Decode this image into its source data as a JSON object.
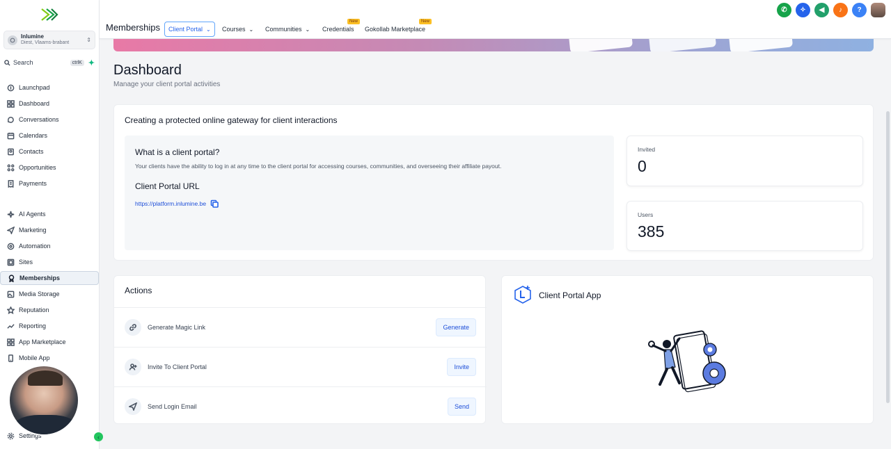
{
  "account": {
    "name": "Inlumine",
    "location": "Diest, Vlaams-brabant"
  },
  "search": {
    "label": "Search",
    "shortcut": "ctrlK"
  },
  "nav": [
    {
      "label": "Launchpad",
      "icon": "rocket-icon"
    },
    {
      "label": "Dashboard",
      "icon": "grid-icon"
    },
    {
      "label": "Conversations",
      "icon": "chat-icon"
    },
    {
      "label": "Calendars",
      "icon": "calendar-icon"
    },
    {
      "label": "Contacts",
      "icon": "contact-icon"
    },
    {
      "label": "Opportunities",
      "icon": "nodes-icon"
    },
    {
      "label": "Payments",
      "icon": "receipt-icon"
    },
    {
      "label": "AI Agents",
      "icon": "sparkle-icon"
    },
    {
      "label": "Marketing",
      "icon": "send-icon"
    },
    {
      "label": "Automation",
      "icon": "automation-icon"
    },
    {
      "label": "Sites",
      "icon": "globe-icon"
    },
    {
      "label": "Memberships",
      "icon": "award-icon",
      "active": true
    },
    {
      "label": "Media Storage",
      "icon": "image-icon"
    },
    {
      "label": "Reputation",
      "icon": "star-icon"
    },
    {
      "label": "Reporting",
      "icon": "trend-icon"
    },
    {
      "label": "App Marketplace",
      "icon": "apps-icon"
    },
    {
      "label": "Mobile App",
      "icon": "phone-icon"
    },
    {
      "label": "Settings",
      "icon": "gear-icon"
    }
  ],
  "header": {
    "title": "Memberships",
    "tabs": [
      {
        "label": "Client Portal"
      },
      {
        "label": "Courses"
      },
      {
        "label": "Communities"
      },
      {
        "label": "Credentials",
        "badge": "New"
      },
      {
        "label": "Gokollab Marketplace",
        "badge": "New"
      }
    ]
  },
  "page": {
    "title": "Dashboard",
    "subtitle": "Manage your client portal activities"
  },
  "gateway": {
    "title": "Creating a protected online gateway for client interactions",
    "question": "What is a client portal?",
    "description": "Your clients have the ability to log in at any time to the client portal for accessing courses, communities, and overseeing their affiliate payout.",
    "url_heading": "Client Portal URL",
    "url": "https://platform.inlumine.be"
  },
  "stats": {
    "invited_label": "Invited",
    "invited_value": "0",
    "users_label": "Users",
    "users_value": "385"
  },
  "actions": {
    "title": "Actions",
    "items": [
      {
        "label": "Generate Magic Link",
        "button": "Generate"
      },
      {
        "label": "Invite To Client Portal",
        "button": "Invite"
      },
      {
        "label": "Send Login Email",
        "button": "Send"
      }
    ]
  },
  "app": {
    "title": "Client Portal App"
  },
  "colors": {
    "accent": "#2563eb",
    "green": "#22c55e",
    "orange": "#f97316"
  }
}
